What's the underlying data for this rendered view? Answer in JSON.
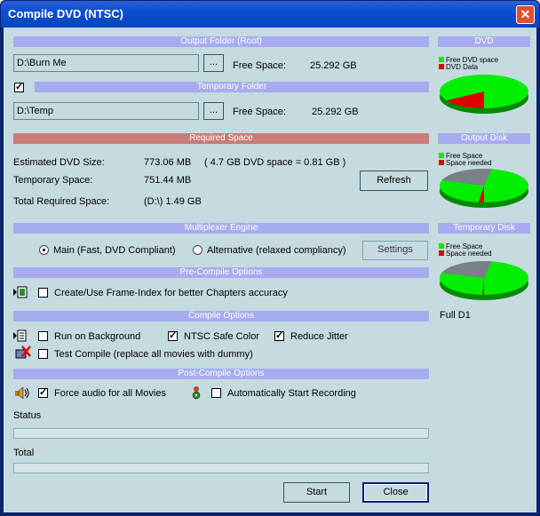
{
  "window": {
    "title": "Compile DVD (NTSC)",
    "close_glyph": "✕"
  },
  "output_folder": {
    "header": "Output Folder (Root)",
    "path": "D:\\Burn Me",
    "browse": "...",
    "free_label": "Free Space:",
    "free_value": "25.292 GB"
  },
  "temp_folder": {
    "header": "Temporary Folder",
    "enabled": true,
    "path": "D:\\Temp",
    "browse": "...",
    "free_label": "Free Space:",
    "free_value": "25.292 GB"
  },
  "required_space": {
    "header": "Required Space",
    "est_label": "Estimated DVD Size:",
    "est_value": "773.06 MB",
    "est_note": "( 4.7 GB DVD space = 0.81 GB )",
    "temp_label": "Temporary Space:",
    "temp_value": "751.44 MB",
    "total_label": "Total Required Space:",
    "total_value": "(D:\\) 1.49 GB",
    "refresh": "Refresh"
  },
  "multiplexer": {
    "header": "Multiplexer Engine",
    "main": "Main (Fast, DVD Compliant)",
    "alt": "Alternative (relaxed compliancy)",
    "settings": "Settings",
    "main_selected": true
  },
  "precompile": {
    "header": "Pre-Compile Options",
    "frame_index": "Create/Use Frame-Index for better Chapters accuracy",
    "frame_index_checked": false
  },
  "compile": {
    "header": "Compile Options",
    "run_bg": "Run on Background",
    "run_bg_checked": false,
    "ntsc_safe": "NTSC Safe Color",
    "ntsc_safe_checked": true,
    "reduce_jitter": "Reduce Jitter",
    "reduce_jitter_checked": true,
    "test_compile": "Test Compile (replace all movies with dummy)",
    "test_compile_checked": false
  },
  "postcompile": {
    "header": "Post-Compile Options",
    "force_audio": "Force audio for all Movies",
    "force_audio_checked": true,
    "auto_record": "Automatically Start Recording",
    "auto_record_checked": false
  },
  "progress": {
    "status_label": "Status",
    "status_fraction": 0.0,
    "total_label": "Total",
    "total_fraction": 0.0
  },
  "buttons": {
    "start": "Start",
    "close": "Close"
  },
  "side": {
    "dvd": {
      "header": "DVD",
      "legend1": "Free DVD space",
      "legend2": "DVD Data",
      "used_fraction": 0.16
    },
    "output_disk": {
      "header": "Output Disk",
      "legend1": "Free Space",
      "legend2": "Space needed",
      "used_fraction": 0.2
    },
    "temp_disk": {
      "header": "Temporary Disk",
      "legend1": "Free Space",
      "legend2": "Space needed",
      "used_fraction": 0.2
    },
    "format": "Full D1"
  },
  "colors": {
    "free": "#00ee00",
    "used": "#dd0000",
    "shadow_used": "#7a7f8a"
  }
}
